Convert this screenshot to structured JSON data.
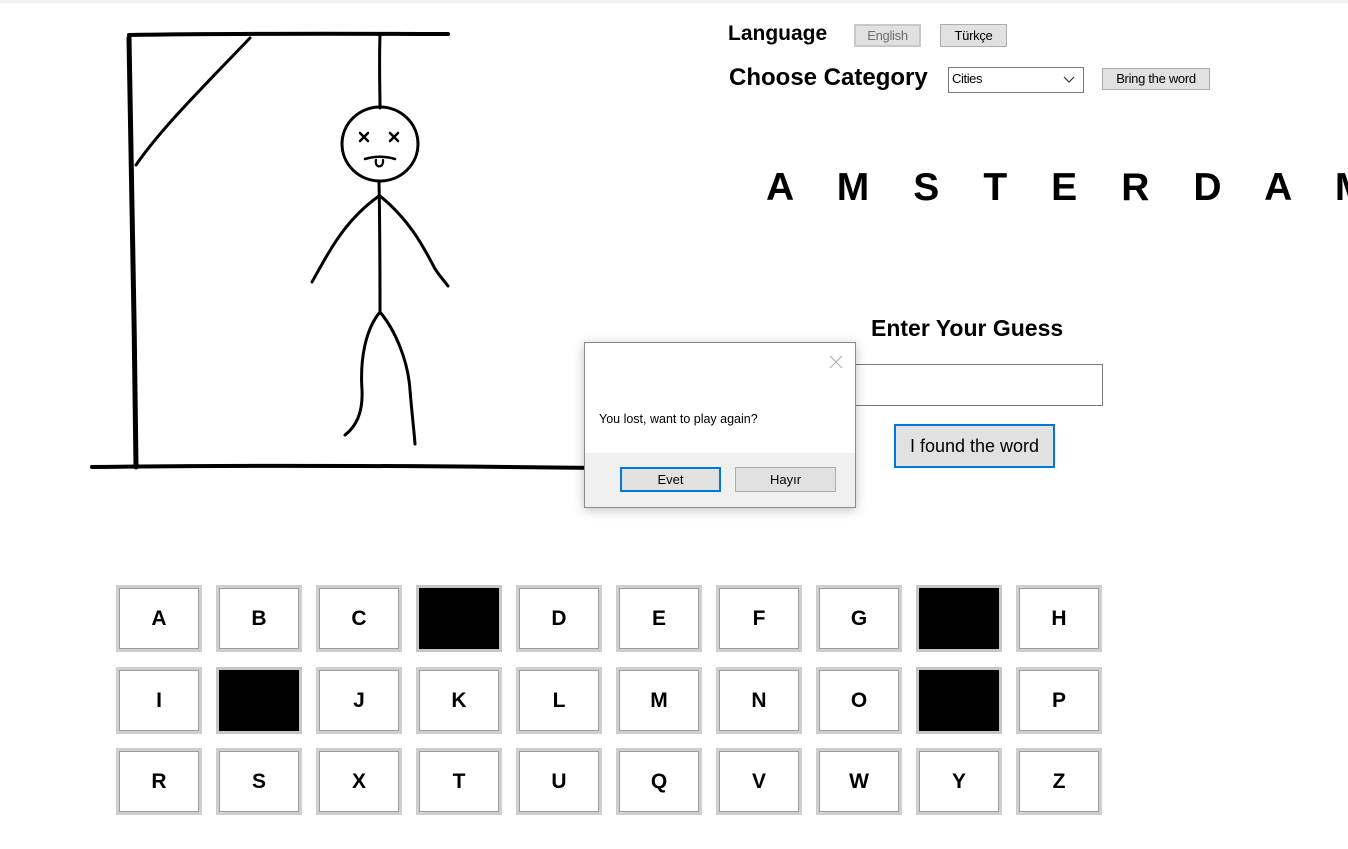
{
  "language": {
    "label": "Language",
    "options": [
      "English",
      "Türkçe"
    ]
  },
  "category": {
    "label": "Choose Category",
    "selected": "Cities",
    "bring_button": "Bring the word"
  },
  "word": "A M S T E R D A M",
  "guess": {
    "label": "Enter Your Guess",
    "value": "",
    "button": "I found the word"
  },
  "dialog": {
    "message": "You lost, want to play again?",
    "yes": "Evet",
    "no": "Hayır"
  },
  "keyboard": {
    "rows": [
      [
        "A",
        "B",
        "C",
        "",
        "D",
        "E",
        "F",
        "G",
        "",
        "H"
      ],
      [
        "I",
        "",
        "J",
        "K",
        "L",
        "M",
        "N",
        "O",
        "",
        "P"
      ],
      [
        "R",
        "S",
        "X",
        "T",
        "U",
        "Q",
        "V",
        "W",
        "Y",
        "Z"
      ]
    ]
  },
  "colors": {
    "accent": "#0078d7",
    "button_bg": "#e1e1e1",
    "used_key": "#000000"
  },
  "icons": {
    "close": "close-icon",
    "dropdown": "chevron-down-icon"
  }
}
